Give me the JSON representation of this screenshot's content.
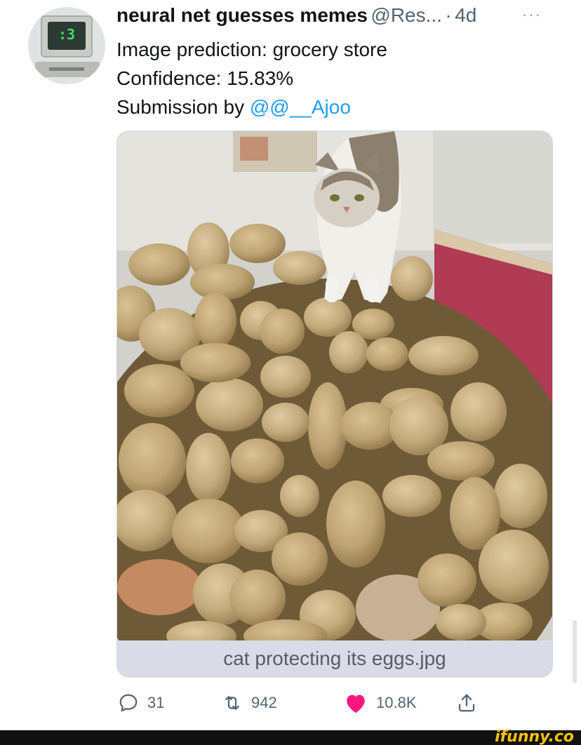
{
  "tweet": {
    "author_name": "neural net guesses memes",
    "author_handle": "@Res...",
    "separator": "·",
    "time": "4d",
    "more": "···",
    "avatar_face": ":3",
    "lines": {
      "prediction": "Image prediction: grocery store",
      "confidence": "Confidence: 15.83%",
      "submission_prefix": "Submission by ",
      "submission_mention": "@@__Ajoo"
    },
    "media": {
      "caption": "cat protecting its eggs.jpg"
    },
    "actions": {
      "replies": "31",
      "retweets": "942",
      "likes": "10.8K"
    }
  },
  "colors": {
    "link": "#1d9bf0",
    "like": "#f91880",
    "muted": "#536471"
  },
  "icons": {
    "reply": "reply-icon",
    "retweet": "retweet-icon",
    "like": "heart-icon",
    "share": "share-icon",
    "more": "more-icon"
  },
  "footer": {
    "watermark": "ifunny.co"
  }
}
